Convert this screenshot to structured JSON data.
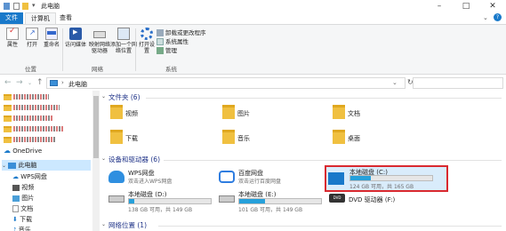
{
  "window": {
    "title": "此电脑"
  },
  "tabs": [
    "文件",
    "计算机",
    "查看"
  ],
  "ribbon": {
    "location": {
      "items": [
        "属性",
        "打开",
        "重命名"
      ],
      "group": "位置"
    },
    "network": {
      "items": [
        "访问媒体",
        "映射网络驱动器",
        "添加一个网络位置"
      ],
      "group": "网络"
    },
    "system": {
      "open": "打开设置",
      "items": [
        "卸载或更改程序",
        "系统属性",
        "管理"
      ],
      "group": "系统"
    }
  },
  "address": {
    "path": "此电脑"
  },
  "navpane": {
    "onedrive": "OneDrive",
    "thispc": "此电脑",
    "children": [
      "WPS网盘",
      "视频",
      "图片",
      "文档",
      "下载",
      "音乐"
    ]
  },
  "sections": {
    "folders": {
      "label": "文件夹 (6)",
      "items": [
        "视频",
        "图片",
        "文档",
        "下载",
        "音乐",
        "桌面"
      ]
    },
    "devices": {
      "label": "设备和驱动器 (6)"
    },
    "network": {
      "label": "网络位置 (1)"
    }
  },
  "devices": {
    "wps": {
      "name": "WPS网盘",
      "sub": "双击进入WPS网盘"
    },
    "baidu": {
      "name": "百度网盘",
      "sub": "双击运行百度网盘"
    },
    "c": {
      "name": "本地磁盘 (C:)",
      "free": "124 GB 可用，共 165 GB",
      "used_fraction": 0.25
    },
    "d": {
      "name": "本地磁盘 (D:)",
      "free": "138 GB 可用，共 149 GB",
      "used_fraction": 0.07
    },
    "e": {
      "name": "本地磁盘 (E:)",
      "free": "101 GB 可用，共 149 GB",
      "used_fraction": 0.32
    },
    "dvd": {
      "name": "DVD 驱动器 (F:)"
    }
  },
  "colors": {
    "accent": "#1979ca",
    "highlight_box": "#d9292f",
    "bar": "#26a0da"
  }
}
